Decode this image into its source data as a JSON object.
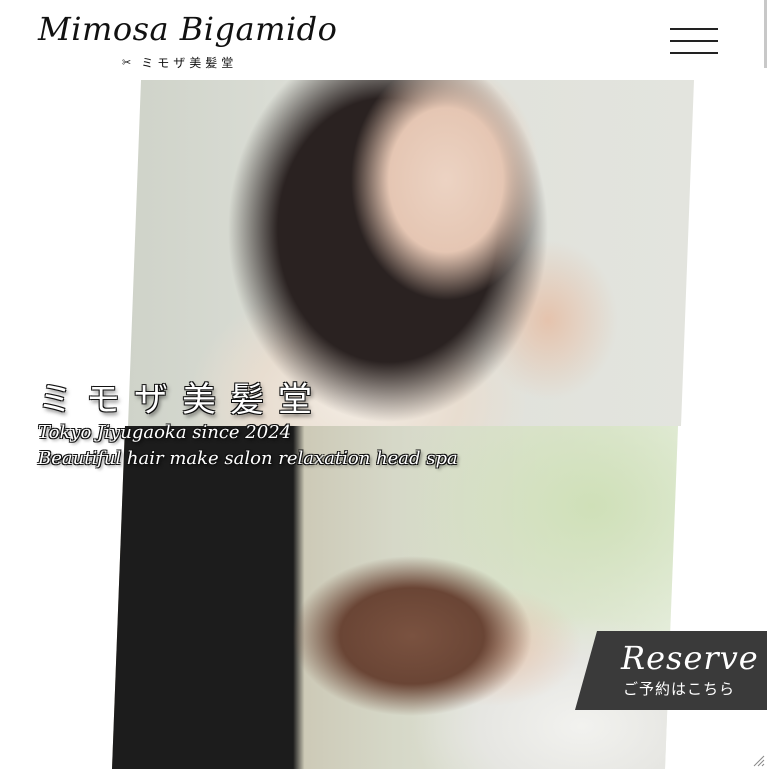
{
  "header": {
    "logo_text": "Mimosa Bigamido",
    "logo_subtitle": "ミモザ美髪堂",
    "scissors_icon": "scissors-icon",
    "menu_icon": "hamburger-menu-icon"
  },
  "hero": {
    "title_jp": "ミモザ美髪堂",
    "tagline_line1": "Tokyo Jiyugaoka since 2024",
    "tagline_line2": "Beautiful hair make salon relaxation head spa",
    "photos": [
      {
        "name": "hero-photo-hair-stylist",
        "alt": ""
      },
      {
        "name": "hero-photo-head-spa",
        "alt": ""
      }
    ]
  },
  "reserve": {
    "title": "Reserve",
    "subtitle": "ご予約はこちら",
    "color": "#3a3a3a"
  },
  "colors": {
    "background": "#ffffff",
    "text": "#111111",
    "accent": "#3a3a3a"
  }
}
